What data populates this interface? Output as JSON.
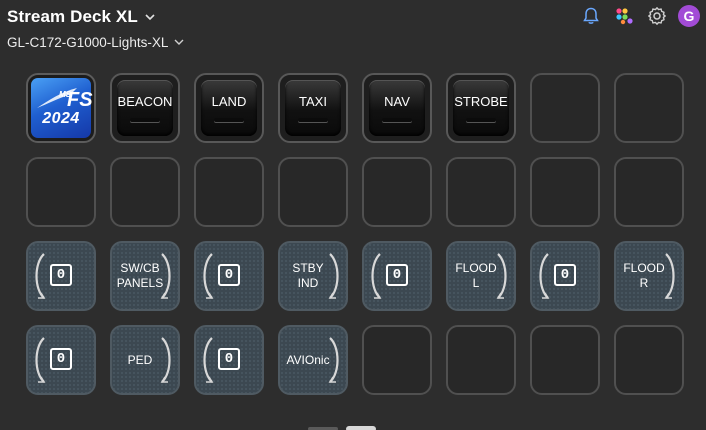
{
  "header": {
    "device_title": "Stream Deck XL",
    "profile_name": "GL-C172-G1000-Lights-XL",
    "user_initial": "G"
  },
  "icons": {
    "notifications": "bell-icon",
    "store": "marketplace-icon",
    "settings": "gear-icon",
    "device_dropdown": "chevron-down-icon",
    "profile_dropdown": "chevron-down-icon"
  },
  "colors": {
    "background": "#2d2d2d",
    "avatar": "#a24bd6",
    "dial_key": "#3c4851",
    "logo_blue": "#1f5fd0"
  },
  "keys": {
    "row1": {
      "logo": {
        "ms": "MS",
        "fs": "FS",
        "year": "2024"
      },
      "k2": "BEACON",
      "k3": "LAND",
      "k4": "TAXI",
      "k5": "NAV",
      "k6": "STROBE"
    },
    "row3": {
      "k1": "0",
      "k2": "SW/CB\nPANELS",
      "k3": "0",
      "k4": "STBY\nIND",
      "k5": "0",
      "k6": "FLOOD L",
      "k7": "0",
      "k8": "FLOOD R"
    },
    "row4": {
      "k1": "0",
      "k2": "PED",
      "k3": "0",
      "k4": "AVIOnic"
    }
  }
}
